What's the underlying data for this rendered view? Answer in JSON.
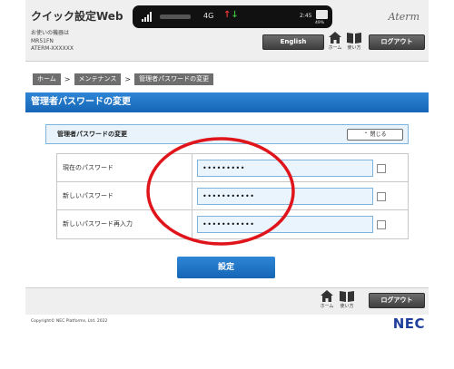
{
  "header": {
    "app_title": "クイック設定Web",
    "device_label": "お使いの機器は",
    "device_model": "MR51FN",
    "device_id": "ATERM-XXXXXX",
    "brand": "Aterm",
    "english_button": "English",
    "home_label": "ホーム",
    "help_label": "使い方",
    "logout_button": "ログアウト"
  },
  "status_bar": {
    "network": "4G",
    "time": "2:45",
    "battery": "49%",
    "up_arrow": "↑",
    "down_arrow": "↓"
  },
  "breadcrumb": {
    "items": [
      "ホーム",
      "メンテナンス",
      "管理者パスワードの変更"
    ],
    "separator": ">"
  },
  "page": {
    "title": "管理者パスワードの変更"
  },
  "section": {
    "title": "管理者パスワードの変更",
    "close_button": "閉じる",
    "close_icon": "chevron-up-icon"
  },
  "form": {
    "rows": [
      {
        "label": "現在のパスワード",
        "value": "password1"
      },
      {
        "label": "新しいパスワード",
        "value": "password123"
      },
      {
        "label": "新しいパスワード再入力",
        "value": "password123"
      }
    ]
  },
  "annotation": {
    "color": "#e0141b"
  },
  "actions": {
    "set_button": "設定"
  },
  "footer": {
    "home_label": "ホーム",
    "help_label": "使い方",
    "logout_button": "ログアウト",
    "copyright": "Copyright© NEC Platforms, Ltd. 2022",
    "logo": "NEC"
  }
}
